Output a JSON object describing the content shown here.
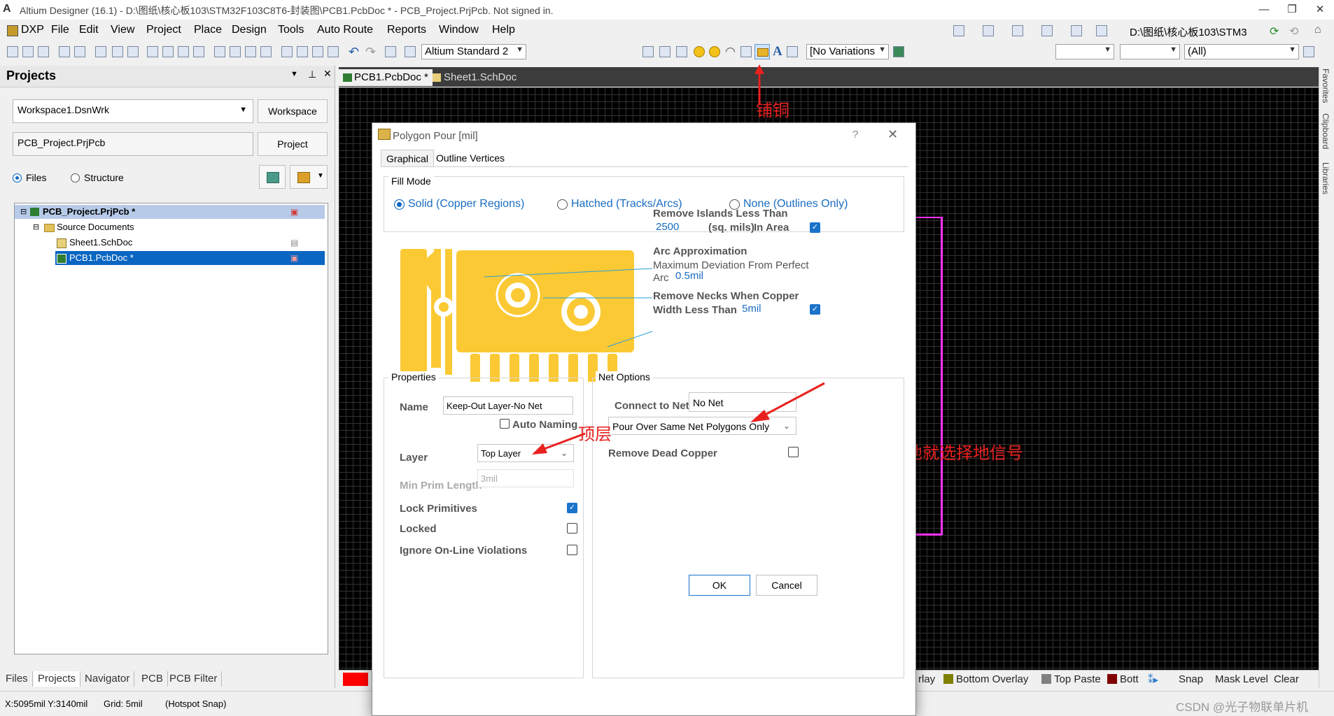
{
  "window": {
    "title": "Altium Designer (16.1) - D:\\图纸\\核心板103\\STM32F103C8T6-封装图\\PCB1.PcbDoc * - PCB_Project.PrjPcb. Not signed in.",
    "min": "—",
    "restore": "❐",
    "close": "✕"
  },
  "menu": [
    "DXP",
    "File",
    "Edit",
    "View",
    "Project",
    "Place",
    "Design",
    "Tools",
    "Auto Route",
    "Reports",
    "Window",
    "Help"
  ],
  "menu_right_path": "D:\\图纸\\核心板103\\STM3",
  "toolbar": {
    "view_config": "Altium Standard 2",
    "variations": "[No Variations",
    "filter_all": "(All)"
  },
  "projects_panel": {
    "title": "Projects",
    "workspace_value": "Workspace1.DsnWrk",
    "workspace_button": "Workspace",
    "project_value": "PCB_Project.PrjPcb",
    "project_button": "Project",
    "radio_files": "Files",
    "radio_structure": "Structure",
    "tree": {
      "project": "PCB_Project.PrjPcb *",
      "folder": "Source Documents",
      "doc1": "Sheet1.SchDoc",
      "doc2": "PCB1.PcbDoc *"
    },
    "bottom_tabs": [
      "Files",
      "Projects",
      "Navigator",
      "PCB",
      "PCB Filter"
    ]
  },
  "doc_tabs": [
    "PCB1.PcbDoc *",
    "Sheet1.SchDoc"
  ],
  "right_panels": [
    "Favorites",
    "Clipboard",
    "Libraries"
  ],
  "layer_bar": {
    "partial": "rlay",
    "bottom_overlay": "Bottom Overlay",
    "top_paste": "Top Paste",
    "bott": "Bott",
    "snap": "Snap",
    "mask_level": "Mask Level",
    "clear": "Clear",
    "colors": {
      "bottom_overlay": "#808000",
      "top_paste": "#808080",
      "bott": "#800000",
      "current": "#ff0000"
    }
  },
  "status": {
    "coords": "X:5095mil Y:3140mil",
    "grid": "Grid: 5mil",
    "snap": "(Hotspot Snap)",
    "watermark": "CSDN @光子物联单片机"
  },
  "annotations": {
    "pour_copper": "铺铜",
    "gnd_hint": "有地就选择地信号",
    "top_layer": "顶层"
  },
  "dialog": {
    "title": "Polygon Pour [mil]",
    "help": "?",
    "close": "✕",
    "tabs": [
      "Graphical",
      "Outline Vertices"
    ],
    "fill_mode": {
      "label": "Fill Mode",
      "solid": "Solid (Copper Regions)",
      "hatched": "Hatched (Tracks/Arcs)",
      "none": "None (Outlines Only)"
    },
    "islands": {
      "label": "Remove Islands Less Than",
      "value": "2500",
      "unit": "(sq. mils)",
      "in_area": "In Area",
      "checked": true
    },
    "arc": {
      "label": "Arc Approximation",
      "desc": "Maximum Deviation From Perfect",
      "arc_word": "Arc",
      "value": "0.5mil"
    },
    "necks": {
      "label1": "Remove Necks When Copper",
      "label2": "Width Less Than",
      "value": "5mil",
      "checked": true
    },
    "properties": {
      "group": "Properties",
      "name_label": "Name",
      "name_value": "Keep-Out Layer-No Net",
      "auto_naming": "Auto Naming",
      "layer_label": "Layer",
      "layer_value": "Top Layer",
      "min_prim_label": "Min Prim Length",
      "min_prim_value": "3mil",
      "lock_primitives": "Lock Primitives",
      "locked": "Locked",
      "ignore_violations": "Ignore On-Line Violations"
    },
    "net_options": {
      "group": "Net Options",
      "connect_label": "Connect to Net",
      "connect_value": "No Net",
      "pour_over": "Pour Over Same Net Polygons Only",
      "remove_dead": "Remove Dead Copper"
    },
    "ok": "OK",
    "cancel": "Cancel"
  }
}
